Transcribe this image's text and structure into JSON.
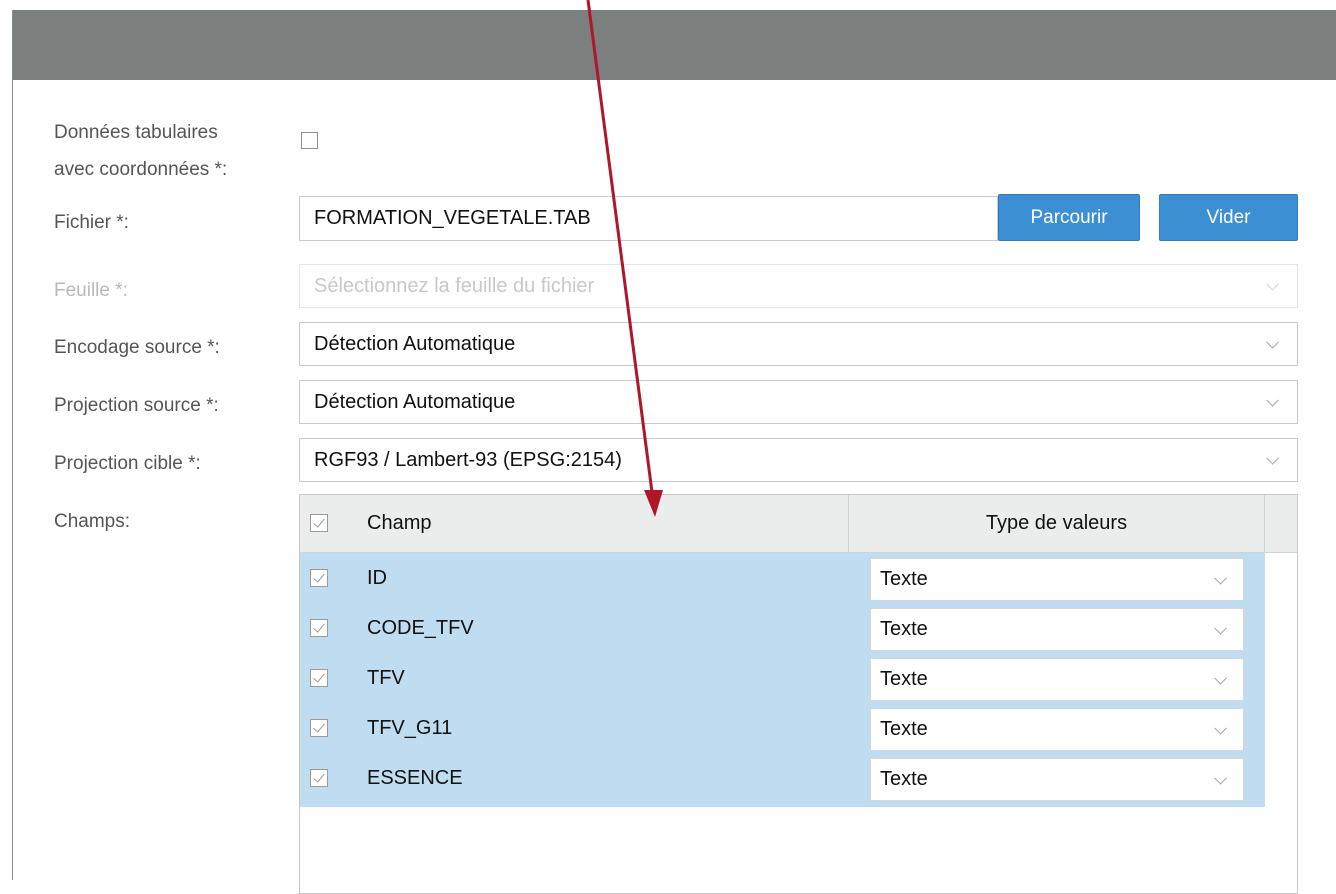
{
  "form": {
    "tabular_label_line1": "Données tabulaires",
    "tabular_label_line2": "avec coordonnées *:",
    "file_label": "Fichier *:",
    "file_value": "FORMATION_VEGETALE.TAB",
    "browse_button": "Parcourir",
    "clear_button": "Vider",
    "sheet_label": "Feuille *:",
    "sheet_placeholder": "Sélectionnez la feuille du fichier",
    "encoding_label": "Encodage source *:",
    "encoding_value": "Détection Automatique",
    "source_projection_label": "Projection source *:",
    "source_projection_value": "Détection Automatique",
    "target_projection_label": "Projection cible *:",
    "target_projection_value": "RGF93 / Lambert-93 (EPSG:2154)",
    "fields_label": "Champs:"
  },
  "grid": {
    "col_champ": "Champ",
    "col_type": "Type de valeurs",
    "rows": [
      {
        "name": "ID",
        "type": "Texte"
      },
      {
        "name": "CODE_TFV",
        "type": "Texte"
      },
      {
        "name": "TFV",
        "type": "Texte"
      },
      {
        "name": "TFV_G11",
        "type": "Texte"
      },
      {
        "name": "ESSENCE",
        "type": "Texte"
      }
    ]
  },
  "colors": {
    "titlebar": "#7b7f7e",
    "button": "#3c8fd3",
    "selected_row": "#bfdcf0",
    "arrow": "#b0162a"
  }
}
